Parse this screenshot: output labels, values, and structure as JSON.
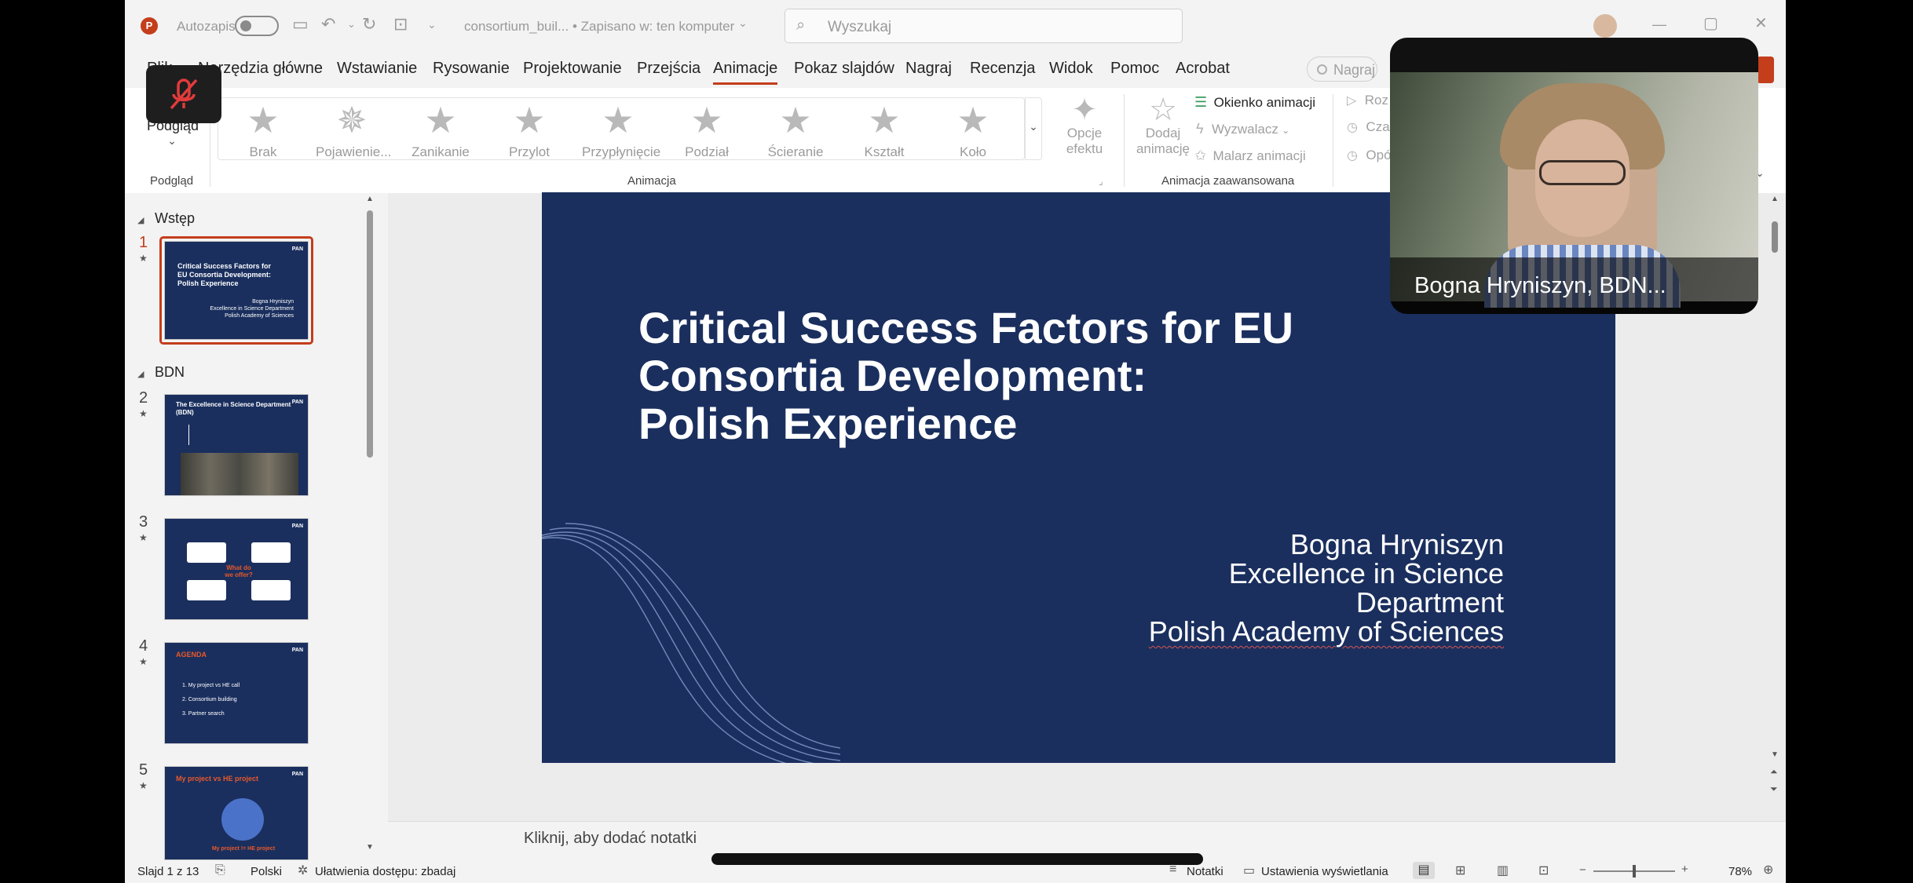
{
  "titlebar": {
    "autosave_label": "Autozapis",
    "filename": "consortium_buil...",
    "save_status": "• Zapisano w: ten komputer",
    "search_placeholder": "Wyszukaj"
  },
  "menu": [
    "Plik",
    "Narzędzia główne",
    "Wstawianie",
    "Rysowanie",
    "Projektowanie",
    "Przejścia",
    "Animacje",
    "Pokaz slajdów",
    "Nagraj",
    "Recenzja",
    "Widok",
    "Pomoc",
    "Acrobat"
  ],
  "active_menu": "Animacje",
  "record_button": "Nagraj",
  "ribbon": {
    "preview_label": "Podgląd",
    "preview_group": "Podgląd",
    "animations": [
      "Brak",
      "Pojawienie...",
      "Zanikanie",
      "Przylot",
      "Przypłynięcie",
      "Podział",
      "Ścieranie",
      "Kształt",
      "Koło"
    ],
    "animation_group": "Animacja",
    "effect_options": [
      "Opcje",
      "efektu"
    ],
    "add_animation": [
      "Dodaj",
      "animację"
    ],
    "advanced": [
      "Okienko animacji",
      "Wyzwalacz",
      "Malarz animacji"
    ],
    "advanced_group": "Animacja zaawansowana",
    "timing": [
      "Roz",
      "Cza",
      "Opó"
    ]
  },
  "sections": [
    "Wstęp",
    "BDN"
  ],
  "thumbnails": [
    {
      "num": "1",
      "title": "Critical Success Factors for EU Consortia Development: Polish Experience",
      "sub": "Bogna Hryniszyn\nExcellence in Science Department\nPolish Academy of Sciences"
    },
    {
      "num": "2",
      "title": "The Excellence in Science Department (BDN)"
    },
    {
      "num": "3",
      "title": "What do we offer?"
    },
    {
      "num": "4",
      "title": "AGENDA",
      "items": [
        "1.  My project vs HE call",
        "2.  Consortium building",
        "3.  Partner search"
      ]
    },
    {
      "num": "5",
      "title": "My project vs HE project",
      "caption": "My project != HE project"
    }
  ],
  "slide": {
    "title": [
      "Critical Success Factors for EU",
      "Consortia Development:",
      "Polish Experience"
    ],
    "subtitle": [
      "Bogna Hryniszyn",
      "Excellence in Science",
      "Department",
      "Polish Academy of Sciences"
    ]
  },
  "notes_placeholder": "Kliknij, aby dodać notatki",
  "status": {
    "slide": "Slajd 1 z 13",
    "language": "Polski",
    "accessibility": "Ułatwienia dostępu: zbadaj",
    "notes": "Notatki",
    "display_settings": "Ustawienia wyświetlania",
    "zoom": "78%"
  },
  "video": {
    "participant": "Bogna Hryniszyn, BDN..."
  },
  "colors": {
    "slide_bg": "#1a2f5e",
    "accent": "#c43e1c",
    "thumb_orange": "#e8582a"
  }
}
